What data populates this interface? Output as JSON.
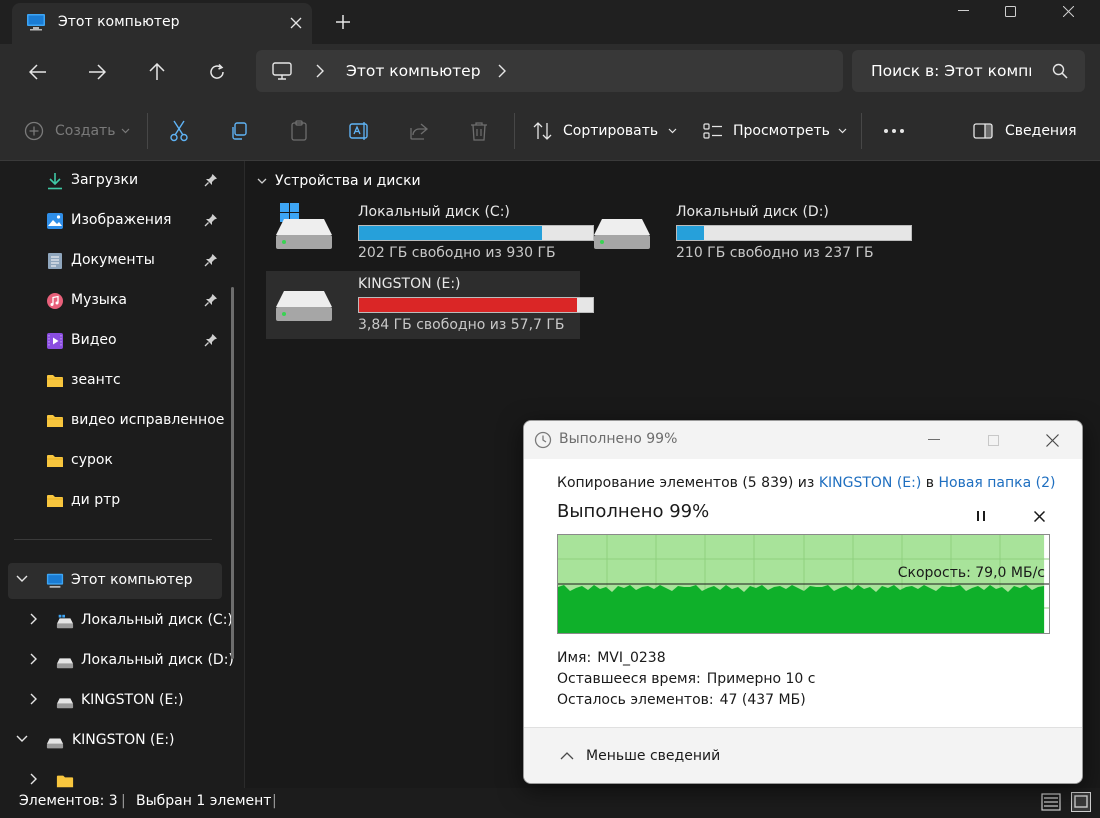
{
  "window": {
    "tab_title": "Этот компьютер",
    "icons": {
      "tab": "computer-icon",
      "close": "close-icon",
      "new_tab": "plus-icon"
    }
  },
  "address": {
    "path_label": "Этот компьютер",
    "search_placeholder": "Поиск в: Этот компьютер"
  },
  "toolbar": {
    "create_label": "Создать",
    "sort_label": "Сортировать",
    "view_label": "Просмотреть",
    "details_label": "Сведения"
  },
  "sidebar": {
    "quick": [
      {
        "label": "Загрузки",
        "icon": "download-icon",
        "pinned": true
      },
      {
        "label": "Изображения",
        "icon": "pictures-icon",
        "pinned": true
      },
      {
        "label": "Документы",
        "icon": "documents-icon",
        "pinned": true
      },
      {
        "label": "Музыка",
        "icon": "music-icon",
        "pinned": true
      },
      {
        "label": "Видео",
        "icon": "video-icon",
        "pinned": true
      },
      {
        "label": "зеантс",
        "icon": "folder-icon",
        "pinned": false
      },
      {
        "label": "видео исправленное",
        "icon": "folder-icon",
        "pinned": false
      },
      {
        "label": "сурок",
        "icon": "folder-icon",
        "pinned": false
      },
      {
        "label": "ди ртр",
        "icon": "folder-icon",
        "pinned": false
      }
    ],
    "this_pc": "Этот компьютер",
    "drives": [
      {
        "label": "Локальный диск (C:)"
      },
      {
        "label": "Локальный диск (D:)"
      },
      {
        "label": "KINGSTON (E:)"
      }
    ],
    "kingston_root": "KINGSTON (E:)"
  },
  "content": {
    "group_title": "Устройства и диски",
    "drives": [
      {
        "name": "Локальный диск (C:)",
        "info": "202 ГБ свободно из 930 ГБ",
        "used_fraction": 0.783,
        "bar_color": "#26a0da",
        "windows": true,
        "selected": false
      },
      {
        "name": "Локальный диск (D:)",
        "info": "210 ГБ свободно из 237 ГБ",
        "used_fraction": 0.114,
        "bar_color": "#26a0da",
        "windows": false,
        "selected": false
      },
      {
        "name": "KINGSTON (E:)",
        "info": "3,84 ГБ свободно из 57,7 ГБ",
        "used_fraction": 0.933,
        "bar_color": "#da2626",
        "windows": false,
        "selected": true
      }
    ]
  },
  "status": {
    "items_count": "Элементов: 3",
    "selected": "Выбран 1 элемент",
    "separator": "|"
  },
  "dialog": {
    "title": "Выполнено 99%",
    "copy_prefix": "Копирование элементов (5 839) из",
    "source": "KINGSTON (E:)",
    "copy_in": "в",
    "destination": "Новая папка (2)",
    "progress_title": "Выполнено 99%",
    "progress_percent": 99,
    "speed": "Скорость: 79,0 МБ/с",
    "name_label": "Имя:",
    "name_value": "MVI_0238",
    "time_label": "Оставшееся время:",
    "time_value": "Примерно 10 с",
    "remaining_label": "Осталось элементов:",
    "remaining_value": "47 (437 МБ)",
    "less_details": "Меньше сведений"
  }
}
